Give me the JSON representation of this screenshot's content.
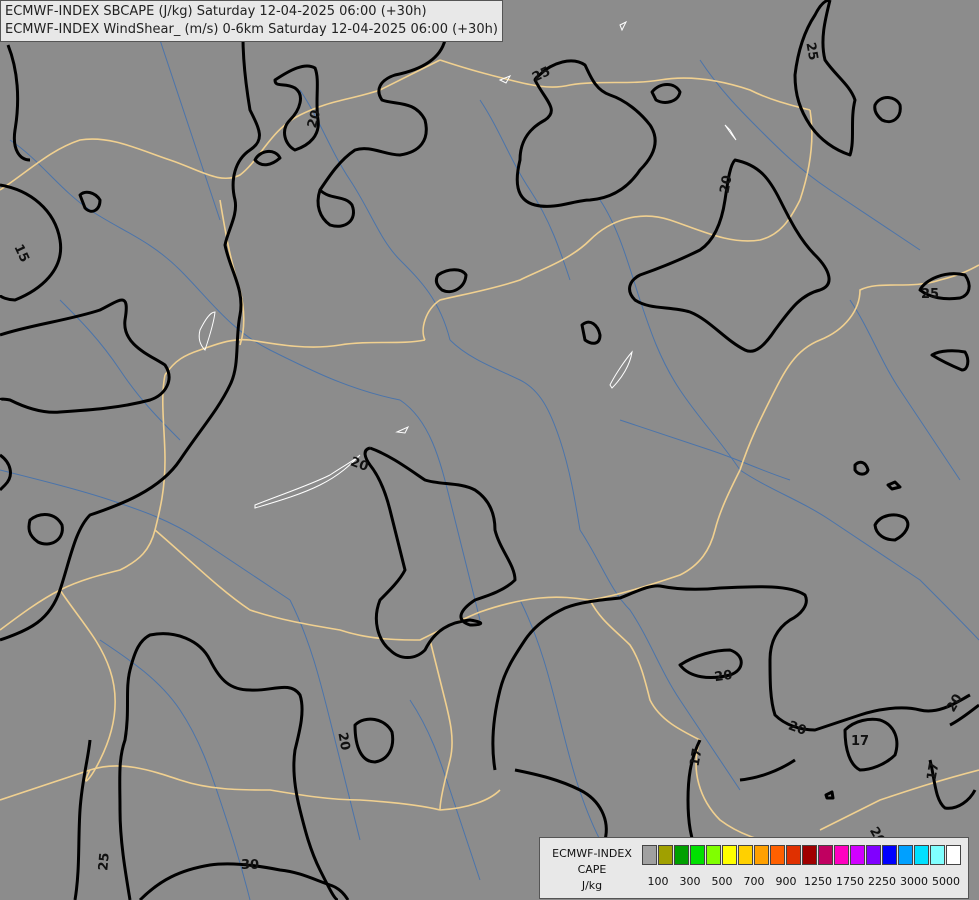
{
  "header": {
    "line1": "ECMWF-INDEX SBCAPE (J/kg) Saturday 12-04-2025 06:00 (+30h)",
    "line2": "ECMWF-INDEX WindShear_ (m/s) 0-6km Saturday 12-04-2025 06:00 (+30h)"
  },
  "legend": {
    "title1": "ECMWF-INDEX",
    "title2": "CAPE",
    "title3": "J/kg",
    "colors": [
      "#a0a0a0",
      "#a0a000",
      "#00a000",
      "#00e000",
      "#80ff00",
      "#ffff00",
      "#ffd000",
      "#ffa000",
      "#ff6000",
      "#e03000",
      "#a00000",
      "#c00060",
      "#ff00c0",
      "#d000ff",
      "#8000ff",
      "#0000ff",
      "#00a0ff",
      "#00e0ff",
      "#80ffff",
      "#ffffff"
    ],
    "tick_labels": [
      "100",
      "300",
      "500",
      "700",
      "900",
      "1250",
      "1750",
      "2250",
      "3000",
      "5000"
    ]
  },
  "map": {
    "contour_labels": [
      "20",
      "25",
      "20",
      "25",
      "20",
      "15",
      "20",
      "25",
      "20",
      "20",
      "17",
      "20",
      "17",
      "17",
      "20",
      "25",
      "30"
    ],
    "colors": {
      "background": "#8c8c8c",
      "border": "#f0d090",
      "river": "#4070b0",
      "contour": "#000000"
    }
  }
}
